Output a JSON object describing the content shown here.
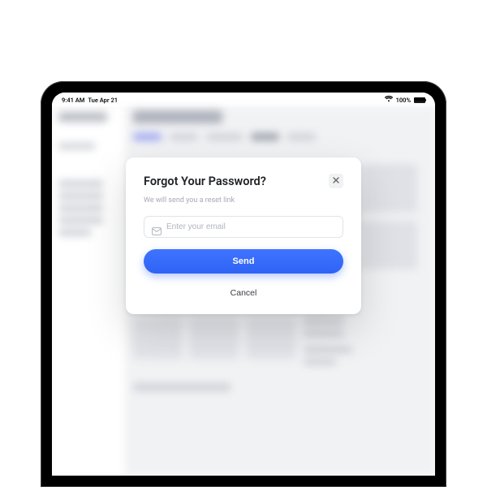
{
  "status_bar": {
    "time": "9:41 AM",
    "date": "Tue Apr 21",
    "battery_pct": "100%"
  },
  "background_app": {
    "title": "Dashboard"
  },
  "modal": {
    "title": "Forgot Your Password?",
    "subtitle": "We will send you a reset link",
    "email_placeholder": "Enter your email",
    "email_value": "",
    "send_label": "Send",
    "cancel_label": "Cancel"
  },
  "colors": {
    "primary": "#2f63f5"
  }
}
